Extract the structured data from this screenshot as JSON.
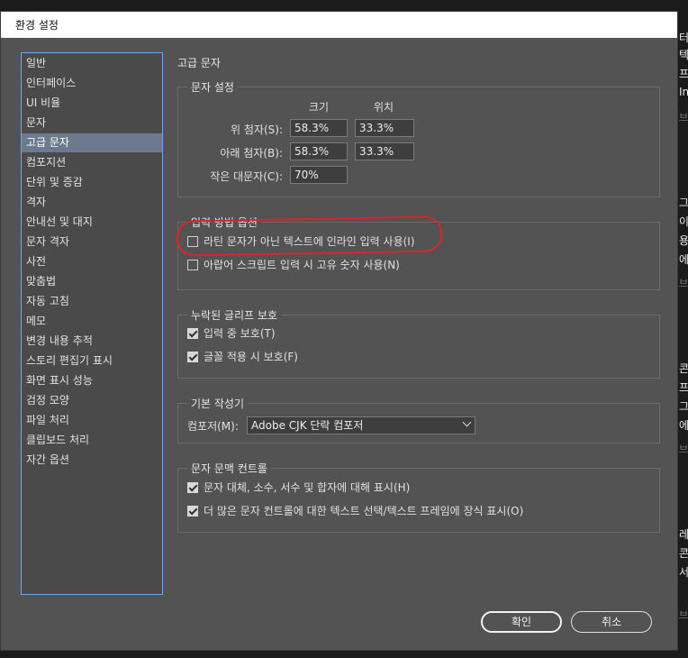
{
  "window": {
    "title": "환경 설정"
  },
  "categories": [
    "일반",
    "인터페이스",
    "UI 비율",
    "문자",
    "고급 문자",
    "컴포지션",
    "단위 및 증감",
    "격자",
    "안내선 및 대지",
    "문자 격자",
    "사전",
    "맞춤법",
    "자동 고침",
    "메모",
    "변경 내용 추적",
    "스토리 편집기 표시",
    "화면 표시 성능",
    "검정 모양",
    "파일 처리",
    "클립보드 처리",
    "자간 옵션"
  ],
  "selected_category": "고급 문자",
  "panel_title": "고급 문자",
  "char_settings": {
    "group_title": "문자 설정",
    "col_size": "크기",
    "col_position": "위치",
    "superscript_label": "위 첨자(S):",
    "superscript_size": "58.3%",
    "superscript_position": "33.3%",
    "subscript_label": "아래 첨자(B):",
    "subscript_size": "58.3%",
    "subscript_position": "33.3%",
    "smallcaps_label": "작은 대문자(C):",
    "smallcaps_value": "70%"
  },
  "input_method": {
    "group_title": "입력 방법 옵션",
    "inline_label": "라틴 문자가 아닌 텍스트에 인라인 입력 사용(I)",
    "inline_checked": false,
    "arabic_label": "아랍어 스크립트 입력 시 고유 숫자 사용(N)",
    "arabic_checked": false
  },
  "glyph_protection": {
    "group_title": "누락된 글리프 보호",
    "typing_label": "입력 중 보호(T)",
    "typing_checked": true,
    "font_label": "글꼴 적용 시 보호(F)",
    "font_checked": true
  },
  "default_composer": {
    "group_title": "기본 작성기",
    "composer_label": "컴포저(M):",
    "composer_value": "Adobe CJK 단락 컴포저"
  },
  "context_controls": {
    "group_title": "문자 문맥 컨트롤",
    "alternates_label": "문자 대체, 소수, 서수 및 합자에 대해 표시(H)",
    "alternates_checked": true,
    "more_controls_label": "더 많은 문자 컨트롤에 대한 텍스트 선택/텍스트 프레임에 장식 표시(O)",
    "more_controls_checked": true
  },
  "buttons": {
    "ok": "확인",
    "cancel": "취소"
  },
  "background_text": [
    "터",
    "텍",
    "프",
    "In",
    "브",
    "그",
    "이",
    "용",
    "에",
    "브",
    "콘",
    "프",
    "그",
    "에",
    "브",
    "레",
    "콘",
    "서",
    "브"
  ],
  "colors": {
    "highlight_annotation": "#d8242e",
    "list_border": "#6fa6e8",
    "selected_item": "#6b7a8e"
  }
}
